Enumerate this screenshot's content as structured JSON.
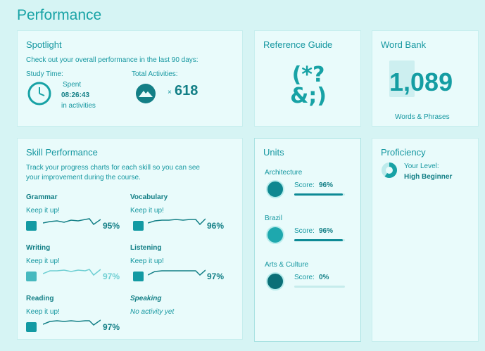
{
  "page": {
    "title": "Performance"
  },
  "spotlight": {
    "title": "Spotlight",
    "subtitle": "Check out your overall performance in the last 90 days:",
    "study_time_label": "Study Time:",
    "spent_label": "Spent",
    "spent_value": "08:26:43",
    "spent_suffix": "in activities",
    "total_label": "Total Activities:",
    "total_prefix": "×",
    "total_value": "618",
    "clock_icon": "clock-icon",
    "mountain_icon": "mountain-icon"
  },
  "reference": {
    "title": "Reference Guide",
    "symbol_line1": "(*?",
    "symbol_line2": "&;)"
  },
  "wordbank": {
    "title": "Word Bank",
    "count": "1,089",
    "caption": "Words & Phrases"
  },
  "skills": {
    "title": "Skill Performance",
    "description_line1": "Track your progress charts for each skill so you can see",
    "description_line2": "your improvement during the course.",
    "items": [
      {
        "name": "Grammar",
        "status": "Keep it up!",
        "percent": "95%",
        "icon": "grammar-icon"
      },
      {
        "name": "Vocabulary",
        "status": "Keep it up!",
        "percent": "96%",
        "icon": "vocabulary-icon"
      },
      {
        "name": "Writing",
        "status": "Keep it up!",
        "percent": "97%",
        "icon": "pencil-icon"
      },
      {
        "name": "Listening",
        "status": "Keep it up!",
        "percent": "97%",
        "icon": "headphones-icon"
      },
      {
        "name": "Reading",
        "status": "Keep it up!",
        "percent": "97%",
        "icon": "glasses-icon"
      },
      {
        "name": "Speaking",
        "status": "No activity yet"
      }
    ]
  },
  "units": {
    "title": "Units",
    "score_label": "Score:",
    "items": [
      {
        "name": "Architecture",
        "score": "96%",
        "progress": 0.96,
        "icon": "architecture-icon"
      },
      {
        "name": "Brazil",
        "score": "96%",
        "progress": 0.96,
        "icon": "brazil-icon"
      },
      {
        "name": "Arts & Culture",
        "score": "0%",
        "progress": 0,
        "icon": "arts-culture-icon"
      }
    ]
  },
  "proficiency": {
    "title": "Proficiency",
    "level_label": "Your Level:",
    "level_value": "High Beginner"
  }
}
